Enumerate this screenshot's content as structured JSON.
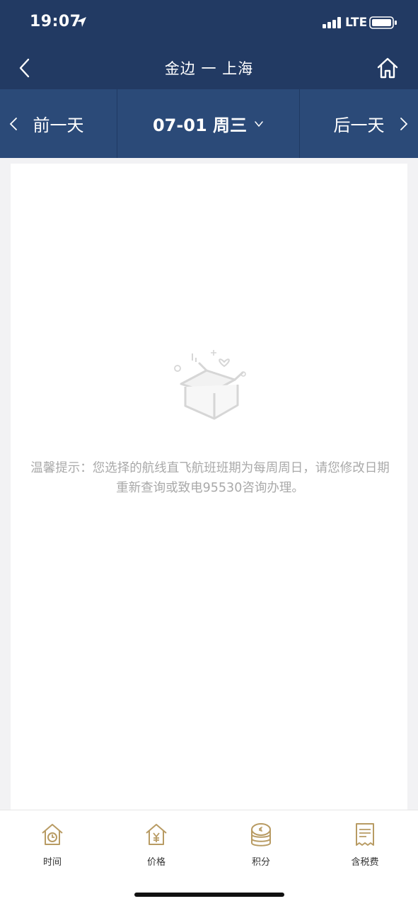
{
  "status": {
    "time": "19:07",
    "network": "LTE"
  },
  "nav": {
    "title": "金边 一 上海"
  },
  "dates": {
    "prev_label": "前一天",
    "current_label": "07-01 周三",
    "next_label": "后一天"
  },
  "notice": {
    "text": "温馨提示：您选择的航线直飞航班班期为每周周日，请您修改日期重新查询或致电95530咨询办理。"
  },
  "tabs": [
    {
      "label": "时间",
      "icon": "clock-house-icon"
    },
    {
      "label": "价格",
      "icon": "yen-house-icon"
    },
    {
      "label": "积分",
      "icon": "coins-icon"
    },
    {
      "label": "含税费",
      "icon": "tax-receipt-icon"
    }
  ],
  "colors": {
    "primary": "#223a63",
    "date_bar": "#2b4a78",
    "accent_gold": "#b89b63",
    "hint_text": "#a9a9a9"
  }
}
